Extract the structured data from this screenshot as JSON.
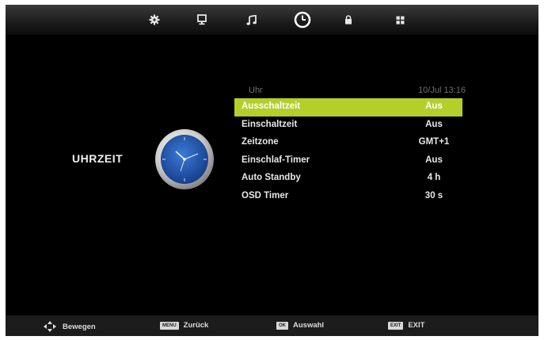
{
  "section_title": "UHRZEIT",
  "tabs": [
    {
      "name": "settings-tab",
      "icon": "gear-icon"
    },
    {
      "name": "picture-tab",
      "icon": "monitor-icon"
    },
    {
      "name": "sound-tab",
      "icon": "music-note-icon"
    },
    {
      "name": "time-tab",
      "icon": "clock-icon",
      "active": true
    },
    {
      "name": "lock-tab",
      "icon": "lock-icon"
    },
    {
      "name": "setup-tab",
      "icon": "grid-icon"
    }
  ],
  "clock_header": {
    "label": "Uhr",
    "value": "10/Jul 13:16"
  },
  "menu": [
    {
      "label": "Ausschaltzeit",
      "value": "Aus",
      "selected": true
    },
    {
      "label": "Einschaltzeit",
      "value": "Aus"
    },
    {
      "label": "Zeitzone",
      "value": "GMT+1"
    },
    {
      "label": "Einschlaf-Timer",
      "value": "Aus"
    },
    {
      "label": "Auto Standby",
      "value": "4 h"
    },
    {
      "label": "OSD Timer",
      "value": "30 s"
    }
  ],
  "footer": {
    "move": {
      "icon": "dpad-icon",
      "label": "Bewegen"
    },
    "back": {
      "key": "MENU",
      "label": "Zurück"
    },
    "select": {
      "key": "OK",
      "label": "Auswahl"
    },
    "exit": {
      "key": "EXIT",
      "label": "EXIT"
    }
  },
  "colors": {
    "highlight": "#b4cf29",
    "background": "#000000",
    "clock_face": "#1f57b5"
  }
}
